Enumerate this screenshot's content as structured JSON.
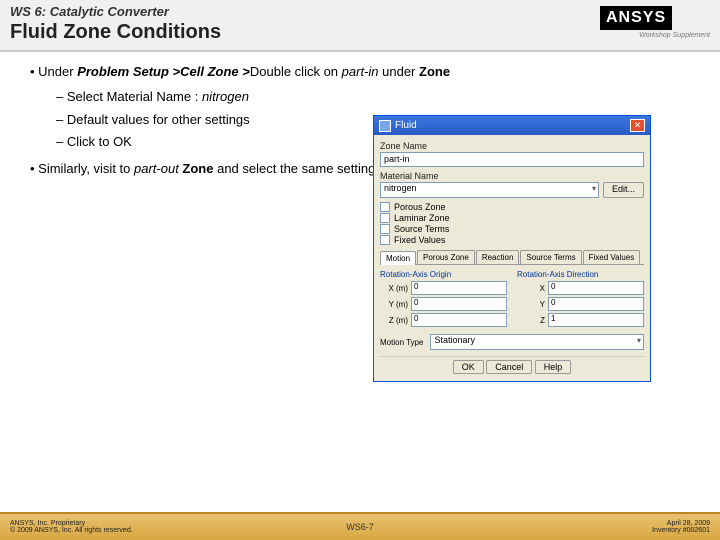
{
  "header": {
    "ws_label": "WS 6: Catalytic Converter",
    "title": "Fluid Zone Conditions",
    "logo_text": "ANSYS",
    "logo_sub": "Workshop Supplement"
  },
  "body": {
    "main_bullet_pre": "Under ",
    "main_bullet_b1": "Problem Setup >",
    "main_bullet_i1": "Cell Zone >",
    "main_bullet_mid": "Double click on ",
    "main_bullet_i2": "part-in",
    "main_bullet_mid2": " under ",
    "main_bullet_b2": "Zone",
    "sub1_pre": "Select Material Name : ",
    "sub1_i": "nitrogen",
    "sub2": "Default values for other settings",
    "sub3": "Click to OK",
    "second_pre": "Similarly, visit to ",
    "second_i": "part-out",
    "second_mid": " Zone",
    "second_post": " and select the same settings as above"
  },
  "dialog": {
    "title": "Fluid",
    "zone_name_label": "Zone Name",
    "zone_name_value": "part-in",
    "material_label": "Material Name",
    "material_value": "nitrogen",
    "edit_btn": "Edit...",
    "chk1": "Porous Zone",
    "chk2": "Laminar Zone",
    "chk3": "Source Terms",
    "chk4": "Fixed Values",
    "tabs": [
      "Motion",
      "Porous Zone",
      "Reaction",
      "Source Terms",
      "Fixed Values"
    ],
    "group1_title": "Rotation-Axis Origin",
    "group2_title": "Rotation-Axis Direction",
    "x_lbl": "X (m)",
    "y_lbl": "Y (m)",
    "z_lbl": "Z (m)",
    "x2_lbl": "X",
    "y2_lbl": "Y",
    "z2_lbl": "Z",
    "x_val": "0",
    "y_val": "0",
    "z_val": "0",
    "x2_val": "0",
    "y2_val": "0",
    "z2_val": "1",
    "motion_type_lbl": "Motion Type",
    "motion_type_val": "Stationary",
    "ok": "OK",
    "cancel": "Cancel",
    "help": "Help"
  },
  "footer": {
    "left1": "ANSYS, Inc. Proprietary",
    "left2": "© 2009 ANSYS, Inc. All rights reserved.",
    "center": "WS6-7",
    "right1": "April 28, 2009",
    "right2": "Inventory #002601"
  }
}
